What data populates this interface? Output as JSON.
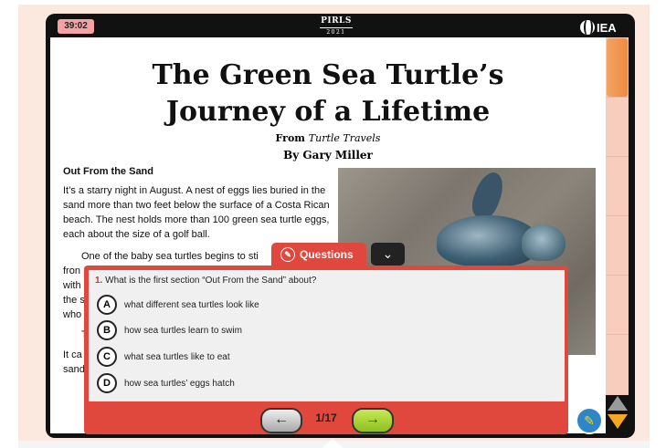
{
  "header": {
    "timer": "39:02",
    "brand_name": "PIRLS",
    "brand_year": "2021",
    "org_logo_text": "IEA"
  },
  "article": {
    "title_line1": "The Green Sea Turtle’s",
    "title_line2": "Journey of a Lifetime",
    "source_prefix": "From",
    "source_title": "Turtle Travels",
    "byline": "By Gary Miller",
    "section_heading": "Out From the Sand",
    "paragraph1": "It’s a starry night in August. A nest of eggs lies buried in the sand more than two feet below the surface of a Costa Rican beach. The nest holds more than 100 green sea turtle eggs, each about the size of a golf ball.",
    "paragraph2_visible": "One of the baby sea turtles begins to sti",
    "fragments": [
      "fron",
      "with",
      "the s",
      "who",
      "T",
      "It ca",
      "sand"
    ]
  },
  "questions_panel": {
    "tab_label": "Questions",
    "question_number": "1.",
    "question_text": "What is the first section “Out From the Sand” about?",
    "options": [
      {
        "letter": "A",
        "text": "what different sea turtles look like"
      },
      {
        "letter": "B",
        "text": "how sea turtles learn to swim"
      },
      {
        "letter": "C",
        "text": "what sea turtles like to eat"
      },
      {
        "letter": "D",
        "text": "how sea turtles’ eggs hatch"
      }
    ],
    "pager": "1/17"
  },
  "icons": {
    "prev": "arrow-left-icon",
    "next": "arrow-right-icon",
    "collapse": "chevron-down-icon",
    "tool": "highlighter-icon",
    "scroll_up": "triangle-up-icon",
    "scroll_down": "triangle-down-icon"
  },
  "colors": {
    "accent_red": "#e0473d",
    "background": "#fbe8de",
    "next_green": "#8fbf20",
    "timer_bg": "#f3a3a3",
    "scroll_thumb": "#ee8a44"
  }
}
